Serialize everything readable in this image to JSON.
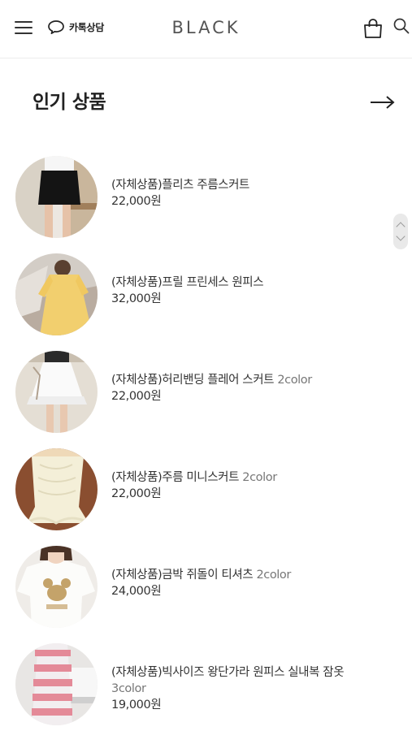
{
  "header": {
    "menu_icon": "hamburger-menu-icon",
    "kakao_label": "카톡상담",
    "kakao_icon": "speech-bubble-icon",
    "logo": "BLACK",
    "cart_icon": "shopping-bag-icon",
    "search_icon": "search-icon"
  },
  "section": {
    "title": "인기 상품",
    "more_icon": "arrow-right-icon"
  },
  "products": [
    {
      "name": "(자체상품)플리츠 주름스커트",
      "variant": "",
      "price": "22,000원"
    },
    {
      "name": "(자체상품)프릴 프린세스 원피스",
      "variant": "",
      "price": "32,000원"
    },
    {
      "name": "(자체상품)허리밴딩 플레어 스커트",
      "variant": "2color",
      "price": "22,000원"
    },
    {
      "name": "(자체상품)주름 미니스커트",
      "variant": "2color",
      "price": "22,000원"
    },
    {
      "name": "(자체상품)금박 쥐돌이 티셔츠",
      "variant": "2color",
      "price": "24,000원"
    },
    {
      "name": "(자체상품)빅사이즈 왕단가라 원피스 실내복 잠옷",
      "variant": "3color",
      "price": "19,000원"
    }
  ],
  "colors": {
    "text": "#222222",
    "muted": "#777777",
    "divider": "#ececec"
  }
}
